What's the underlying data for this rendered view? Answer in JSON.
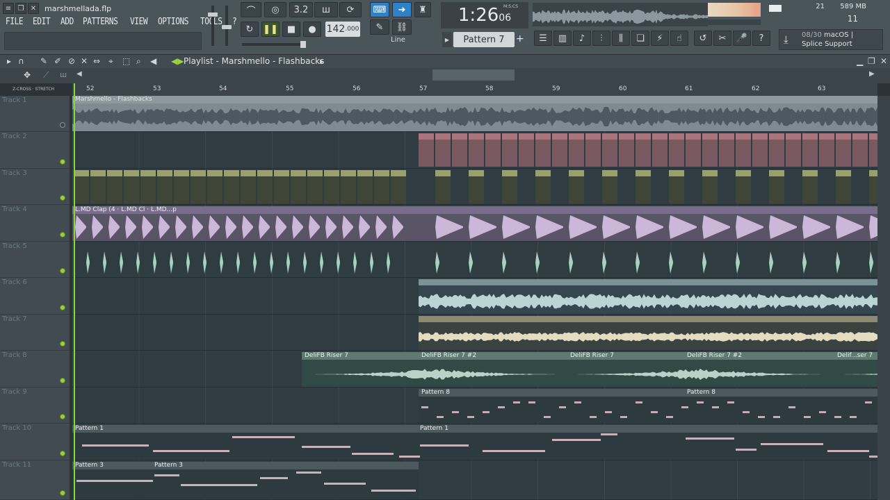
{
  "window": {
    "file_name": "marshmellada.flp",
    "icons": [
      "menu-lines-icon",
      "restore-icon",
      "close-icon"
    ]
  },
  "menu": [
    "FILE",
    "EDIT",
    "ADD",
    "PATTERNS",
    "VIEW",
    "OPTIONS",
    "TOOLS",
    "?"
  ],
  "transport": {
    "bpm_main": "142",
    "bpm_frac": ".000",
    "snap_mode": "Line",
    "time_main": "1:26",
    "time_sub": "06",
    "time_format": "M:S:CS",
    "pattern_label": "Pattern 7",
    "pattern_add": "+"
  },
  "status": {
    "cpu": "21",
    "memory": "589 MB",
    "voices": "11"
  },
  "news": {
    "count": "08/30",
    "text_line1": "macOS |",
    "text_line2": "Splice Support"
  },
  "playlist": {
    "title": "Playlist - Marshmello - Flashbacks",
    "zcross_label": "Z-CROSS",
    "stretch_label": "STRETCH",
    "bars": [
      "52",
      "53",
      "54",
      "55",
      "56",
      "57",
      "58",
      "59",
      "60",
      "61",
      "62",
      "63"
    ]
  },
  "tracks": [
    {
      "name": "Track 1",
      "led": "off"
    },
    {
      "name": "Track 2",
      "led": "on"
    },
    {
      "name": "Track 3",
      "led": "on"
    },
    {
      "name": "Track 4",
      "led": "on"
    },
    {
      "name": "Track 5",
      "led": "on"
    },
    {
      "name": "Track 6",
      "led": "on"
    },
    {
      "name": "Track 7",
      "led": "on"
    },
    {
      "name": "Track 8",
      "led": "on"
    },
    {
      "name": "Track 9",
      "led": "on"
    },
    {
      "name": "Track 10",
      "led": "on"
    },
    {
      "name": "Track 11",
      "led": "on"
    }
  ],
  "clips": {
    "track1": "Marshmello - Flashbacks",
    "track4_a": "L.MD Clap (4",
    "track4_b": "L.MD Cl",
    "track4_c": "L.MD...p",
    "track8": [
      "DeliFB Riser 7",
      "DeliFB Riser 7 #2",
      "DeliFB Riser 7",
      "DeliFB Riser 7 #2",
      "Delif...ser 7"
    ],
    "track9": [
      "Pattern 8",
      "Pattern 8"
    ],
    "track10": [
      "Pattern 1",
      "Pattern 1"
    ],
    "track11": [
      "Pattern 3",
      "Pattern 3"
    ]
  },
  "colors": {
    "playhead": "#8bd83a",
    "track2_clip": "#d8a7b0",
    "track3_clip": "#9aa26b",
    "track4_clip": "#b79bc7",
    "track5_clip": "#9fc9b5",
    "track6_clip": "#a6c3c8",
    "track7_clip": "#d2c9a8",
    "track8_clip": "#9ab7a8"
  }
}
